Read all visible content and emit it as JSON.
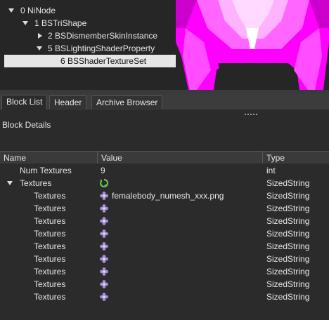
{
  "tree": {
    "nodes": [
      {
        "label": "0 NiNode",
        "expanded": true
      },
      {
        "label": "1 BSTriShape",
        "expanded": true
      },
      {
        "label": "2 BSDismemberSkinInstance",
        "expanded": false
      },
      {
        "label": "5 BSLightingShaderProperty",
        "expanded": true
      },
      {
        "label": "6 BSShaderTextureSet",
        "selected": true
      }
    ]
  },
  "tabs": [
    {
      "label": "Block List",
      "active": true
    },
    {
      "label": "Header",
      "active": false
    },
    {
      "label": "Archive Browser",
      "active": false
    }
  ],
  "details": {
    "title": "Block Details",
    "columns": {
      "name": "Name",
      "value": "Value",
      "type": "Type"
    },
    "rows": [
      {
        "name": "Num Textures",
        "value": "9",
        "type": "int"
      },
      {
        "name": "Textures",
        "value": "",
        "type": "SizedString",
        "icon": "refresh-icon"
      },
      {
        "name": "Textures",
        "value": "femalebody_numesh_xxx.png",
        "type": "SizedString",
        "icon": "flower-icon"
      },
      {
        "name": "Textures",
        "value": "",
        "type": "SizedString",
        "icon": "flower-icon"
      },
      {
        "name": "Textures",
        "value": "",
        "type": "SizedString",
        "icon": "flower-icon"
      },
      {
        "name": "Textures",
        "value": "",
        "type": "SizedString",
        "icon": "flower-icon"
      },
      {
        "name": "Textures",
        "value": "",
        "type": "SizedString",
        "icon": "flower-icon"
      },
      {
        "name": "Textures",
        "value": "",
        "type": "SizedString",
        "icon": "flower-icon"
      },
      {
        "name": "Textures",
        "value": "",
        "type": "SizedString",
        "icon": "flower-icon"
      },
      {
        "name": "Textures",
        "value": "",
        "type": "SizedString",
        "icon": "flower-icon"
      },
      {
        "name": "Textures",
        "value": "",
        "type": "SizedString",
        "icon": "flower-icon"
      }
    ]
  },
  "colors": {
    "mesh_primary": "#ff00ff",
    "mesh_highlight": "#ffd9ff"
  }
}
